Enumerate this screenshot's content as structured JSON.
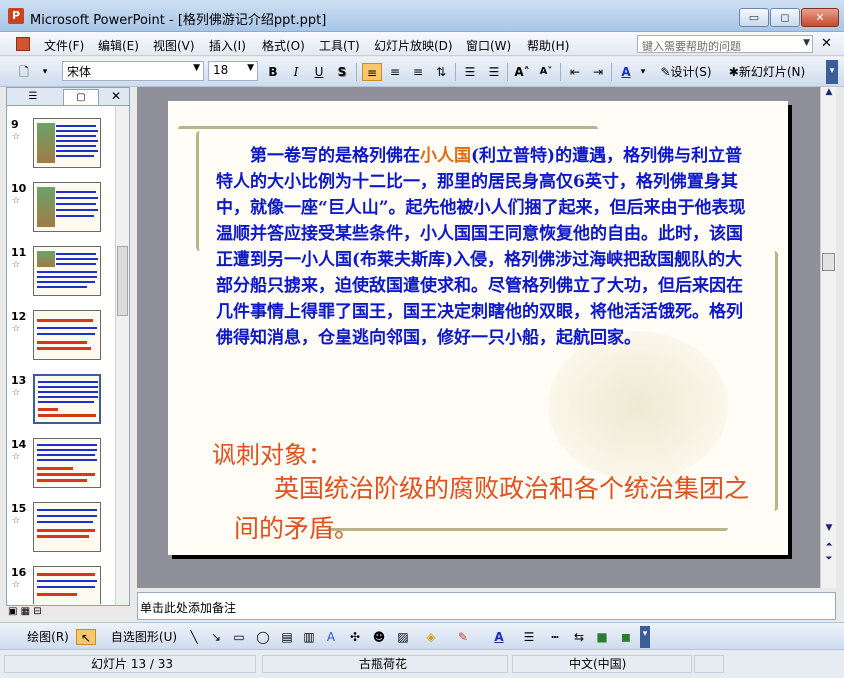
{
  "window": {
    "title": "Microsoft PowerPoint - [格列佛游记介绍ppt.ppt]",
    "app_icon": "P",
    "min_symbol": "▭",
    "max_symbol": "◻",
    "close_symbol": "✕"
  },
  "menu": {
    "items": [
      "文件(F)",
      "编辑(E)",
      "视图(V)",
      "插入(I)",
      "格式(O)",
      "工具(T)",
      "幻灯片放映(D)",
      "窗口(W)",
      "帮助(H)"
    ],
    "help_placeholder": "键入需要帮助的问题",
    "close_doc": "✕"
  },
  "toolbar": {
    "font_name": "宋体",
    "font_size": "18",
    "bold": "B",
    "italic": "I",
    "underline": "U",
    "shadow": "S",
    "design_label": "设计(S)",
    "new_slide_label": "新幻灯片(N)"
  },
  "left_pane": {
    "close_symbol": "✕",
    "slides": [
      {
        "num": "9",
        "star": "☆"
      },
      {
        "num": "10",
        "star": "☆"
      },
      {
        "num": "11",
        "star": "☆"
      },
      {
        "num": "12",
        "star": "☆"
      },
      {
        "num": "13",
        "star": "☆"
      },
      {
        "num": "14",
        "star": "☆"
      },
      {
        "num": "15",
        "star": "☆"
      },
      {
        "num": "16",
        "star": "☆"
      }
    ],
    "selected_slide": "13"
  },
  "slide": {
    "body_before": "第一卷写的是格列佛在",
    "body_highlight": "小人国",
    "body_after": "(利立普特)的遭遇，格列佛与利立普特人的大小比例为十二比一，那里的居民身高仅6英寸，格列佛置身其中，就像一座“巨人山”。起先他被小人们捆了起来，但后来由于他表现温顺并答应接受某些条件，小人国国王同意恢复他的自由。此时，该国正遭到另一小人国(布莱夫斯库)入侵，格列佛涉过海峡把敌国舰队的大部分船只掳来，迫使敌国遣使求和。尽管格列佛立了大功，但后来因在几件事情上得罪了国王，国王决定刺瞎他的双眼，将他活活饿死。格列佛得知消息，仓皇逃向邻国，修好一只小船，起航回家。",
    "satire_label": "讽刺对象：",
    "satire_body": "英国统治阶级的腐败政治和各个统治集团之间的矛盾。"
  },
  "notes": {
    "placeholder": "单击此处添加备注"
  },
  "draw_toolbar": {
    "draw_label": "绘图(R)",
    "autoshape_label": "自选图形(U)"
  },
  "status": {
    "slide_info": "幻灯片 13 / 33",
    "design": "古瓶荷花",
    "language": "中文(中国)"
  }
}
